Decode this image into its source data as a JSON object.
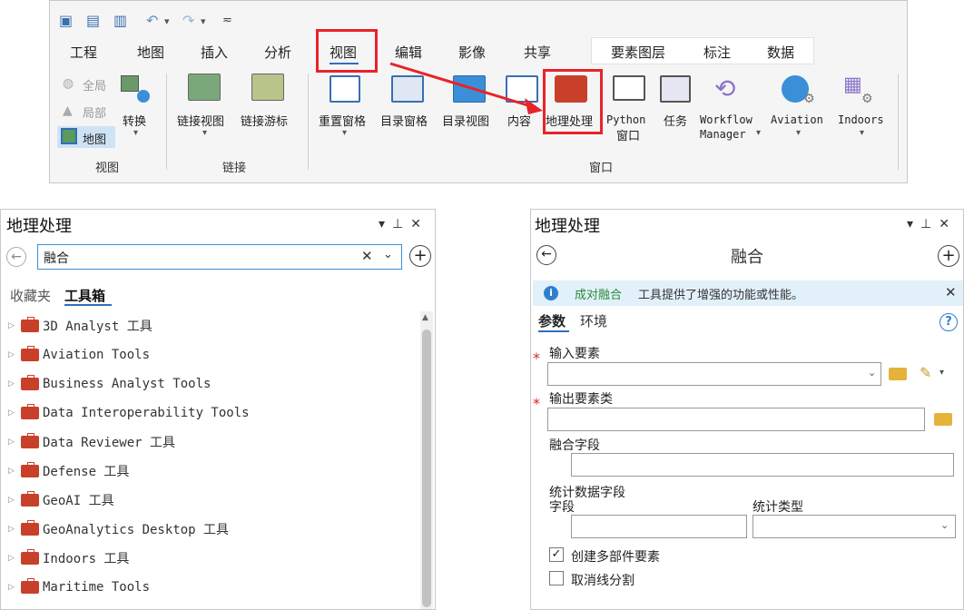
{
  "ribbon": {
    "tabs": [
      "工程",
      "地图",
      "插入",
      "分析",
      "视图",
      "编辑",
      "影像",
      "共享"
    ],
    "context_tabs": [
      "要素图层",
      "标注",
      "数据"
    ],
    "active_tab": "视图",
    "view_group": {
      "items": [
        "全局",
        "局部",
        "地图"
      ],
      "convert_label": "转换",
      "group_label": "视图"
    },
    "link_group": {
      "items": [
        "链接视图",
        "链接游标"
      ],
      "group_label": "链接"
    },
    "window_group": {
      "items": [
        "重置窗格",
        "目录窗格",
        "目录视图",
        "内容",
        "地理处理"
      ],
      "python": [
        "Python",
        "窗口"
      ],
      "task": "任务",
      "workflow": [
        "Workflow",
        "Manager"
      ],
      "aviation": "Aviation",
      "indoors": "Indoors",
      "group_label": "窗口"
    }
  },
  "left_panel": {
    "title": "地理处理",
    "search_value": "融合",
    "tabs": [
      "收藏夹",
      "工具箱"
    ],
    "tools": [
      "3D Analyst 工具",
      "Aviation Tools",
      "Business Analyst Tools",
      "Data Interoperability Tools",
      "Data Reviewer 工具",
      "Defense 工具",
      "GeoAI 工具",
      "GeoAnalytics Desktop 工具",
      "Indoors 工具",
      "Maritime Tools"
    ]
  },
  "right_panel": {
    "title": "地理处理",
    "tool_name": "融合",
    "info_link": "成对融合",
    "info_text": "工具提供了增强的功能或性能。",
    "tabs": [
      "参数",
      "环境"
    ],
    "fields": {
      "input": "输入要素",
      "output": "输出要素类",
      "dissolve": "融合字段",
      "stats_label_1": "统计数据字段",
      "stats_label_2": "字段",
      "stats_type": "统计类型"
    },
    "checkboxes": [
      {
        "label": "创建多部件要素",
        "checked": true
      },
      {
        "label": "取消线分割",
        "checked": false
      }
    ]
  }
}
